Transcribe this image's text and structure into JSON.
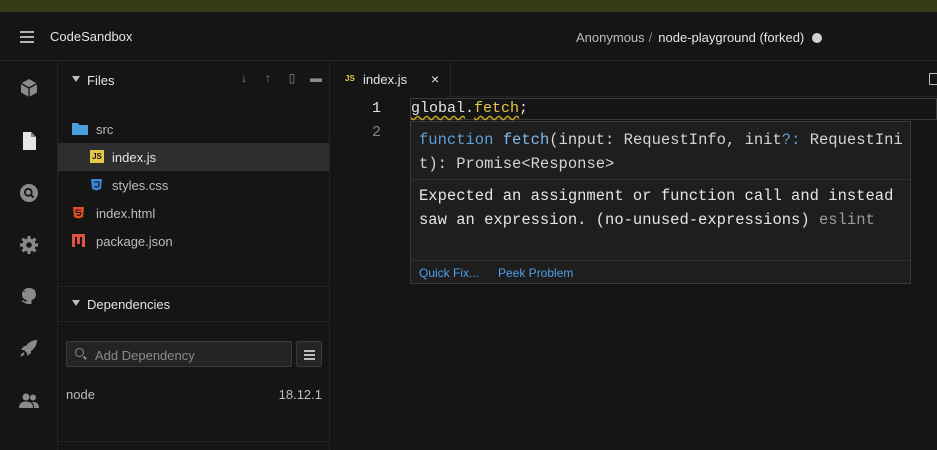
{
  "header": {
    "brand": "CodeSandbox",
    "owner": "Anonymous",
    "separator": "/",
    "project": "node-playground (forked)"
  },
  "activity_bar": {
    "icons": [
      "cube-icon",
      "file-icon",
      "search-icon",
      "gear-icon",
      "github-icon",
      "rocket-icon",
      "users-icon"
    ]
  },
  "files": {
    "title": "Files",
    "tree": [
      {
        "label": "src",
        "type": "folder"
      },
      {
        "label": "index.js",
        "type": "js",
        "active": true
      },
      {
        "label": "styles.css",
        "type": "css"
      },
      {
        "label": "index.html",
        "type": "html"
      },
      {
        "label": "package.json",
        "type": "json"
      }
    ]
  },
  "dependencies": {
    "title": "Dependencies",
    "placeholder": "Add Dependency",
    "items": [
      {
        "name": "node",
        "version": "18.12.1"
      }
    ]
  },
  "tab": {
    "icon": "JS",
    "name": "index.js",
    "close": "×"
  },
  "editor": {
    "line_numbers": [
      "1",
      "2"
    ],
    "code": {
      "obj": "global",
      "dot": ".",
      "member": "fetch",
      "semi": ";"
    }
  },
  "hover": {
    "sig_kw": "function",
    "sig_name": "fetch",
    "sig_rest_1": "(input: RequestInfo, init",
    "sig_opt": "?:",
    "sig_rest_2": " RequestInit",
    "sig_rest_3": "): Promise<Response>",
    "message": "Expected an assignment or function call and instead saw an expression. (no-unused-expressions)",
    "source": "eslint",
    "quick_fix": "Quick Fix...",
    "peek_problem": "Peek Problem"
  },
  "colors": {
    "accent_link": "#4d9fe8",
    "keyword": "#5c9fd6",
    "warning_squiggle": "#c9a626",
    "js_icon": "#e8c84a",
    "html_icon": "#e44d26"
  }
}
